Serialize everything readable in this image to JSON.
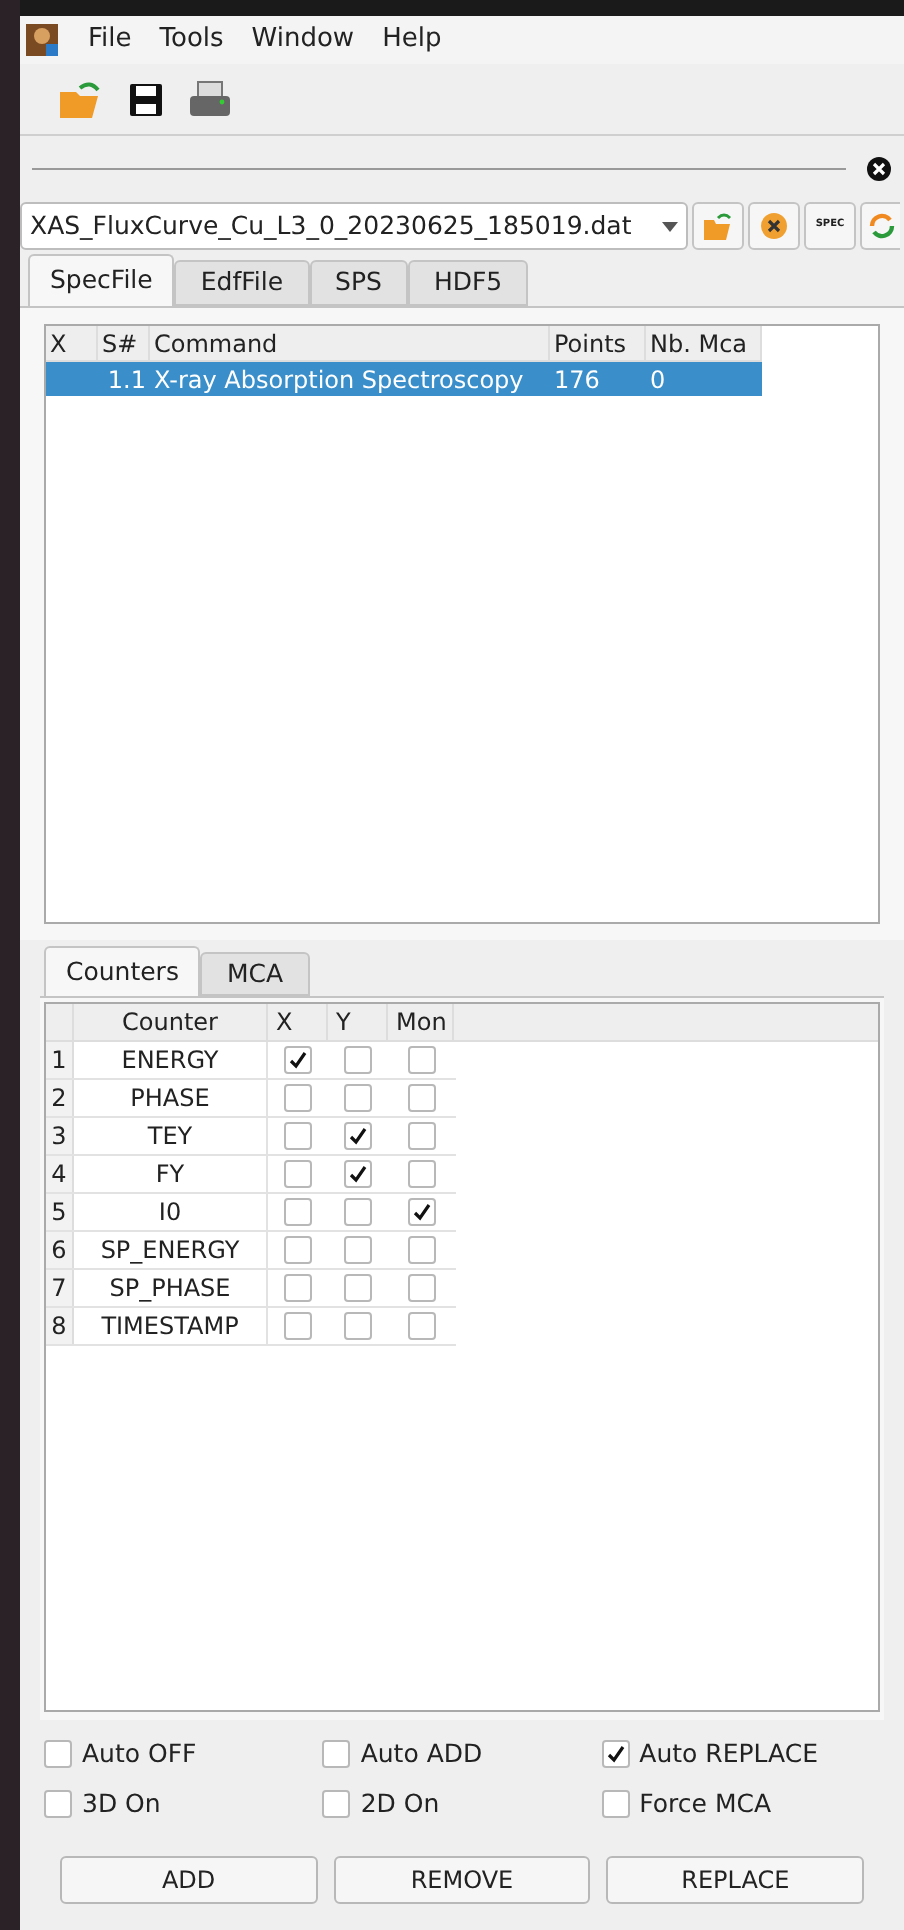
{
  "menu": [
    "File",
    "Tools",
    "Window",
    "Help"
  ],
  "file_selector": {
    "value": "XAS_FluxCurve_Cu_L3_0_20230625_185019.dat",
    "spec_button": "SPEC"
  },
  "source_tabs": [
    {
      "label": "SpecFile",
      "selected": true
    },
    {
      "label": "EdfFile",
      "selected": false
    },
    {
      "label": "SPS",
      "selected": false
    },
    {
      "label": "HDF5",
      "selected": false
    }
  ],
  "scan_table": {
    "columns": [
      "X",
      "S#",
      "Command",
      "Points",
      "Nb. Mca"
    ],
    "rows": [
      {
        "cells": [
          "",
          "1.1",
          "X-ray Absorption Spectroscopy",
          "176",
          "0"
        ],
        "selected": true
      }
    ]
  },
  "counter_tabs": [
    {
      "label": "Counters",
      "selected": true
    },
    {
      "label": "MCA",
      "selected": false
    }
  ],
  "counter_table": {
    "columns": [
      "Counter",
      "X",
      "Y",
      "Mon"
    ],
    "rows": [
      {
        "index": "1",
        "name": "ENERGY",
        "x": true,
        "y": false,
        "mon": false
      },
      {
        "index": "2",
        "name": "PHASE",
        "x": false,
        "y": false,
        "mon": false
      },
      {
        "index": "3",
        "name": "TEY",
        "x": false,
        "y": true,
        "mon": false
      },
      {
        "index": "4",
        "name": "FY",
        "x": false,
        "y": true,
        "mon": false
      },
      {
        "index": "5",
        "name": "I0",
        "x": false,
        "y": false,
        "mon": true
      },
      {
        "index": "6",
        "name": "SP_ENERGY",
        "x": false,
        "y": false,
        "mon": false
      },
      {
        "index": "7",
        "name": "SP_PHASE",
        "x": false,
        "y": false,
        "mon": false
      },
      {
        "index": "8",
        "name": "TIMESTAMP",
        "x": false,
        "y": false,
        "mon": false
      }
    ]
  },
  "options": [
    {
      "label": "Auto OFF",
      "checked": false
    },
    {
      "label": "Auto ADD",
      "checked": false
    },
    {
      "label": "Auto REPLACE",
      "checked": true
    },
    {
      "label": "3D On",
      "checked": false
    },
    {
      "label": "2D On",
      "checked": false
    },
    {
      "label": "Force MCA",
      "checked": false
    }
  ],
  "buttons": [
    "ADD",
    "REMOVE",
    "REPLACE"
  ]
}
